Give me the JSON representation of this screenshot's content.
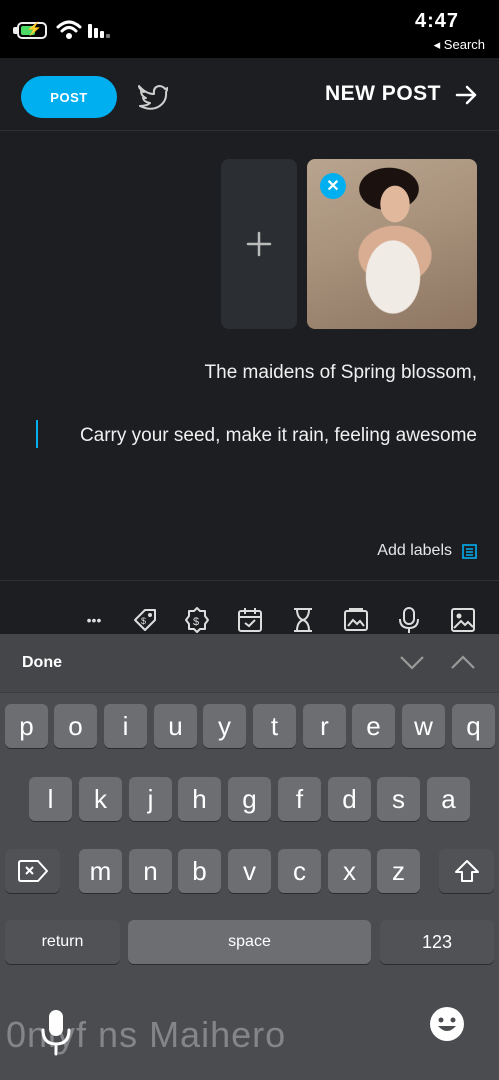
{
  "status_bar": {
    "time": "4:47",
    "back_app": "◂ Search"
  },
  "header": {
    "title": "NEW POST",
    "post_label": "POST"
  },
  "post": {
    "line1": "The maidens of Spring blossom,",
    "line2": "Carry your seed, make it rain, feeling awesome"
  },
  "labels": {
    "add_label": "Add labels"
  },
  "toolbar": {
    "items": [
      "image-icon",
      "microphone-icon",
      "media-vault-icon",
      "hourglass-icon",
      "calendar-icon",
      "price-icon",
      "tag-icon",
      "more-icon"
    ],
    "more": "•••"
  },
  "keyboard": {
    "done": "Done",
    "row1": [
      "q",
      "w",
      "e",
      "r",
      "t",
      "y",
      "u",
      "i",
      "o",
      "p"
    ],
    "row2": [
      "a",
      "s",
      "d",
      "f",
      "g",
      "h",
      "j",
      "k",
      "l"
    ],
    "row3": [
      "z",
      "x",
      "c",
      "v",
      "b",
      "n",
      "m"
    ],
    "numbers": "123",
    "space": "space",
    "return": "return"
  },
  "watermark": "0nlyf ns Maihero",
  "colors": {
    "accent": "#00aff0",
    "background": "#1c1e22",
    "keyboard": "#4a4c50"
  }
}
